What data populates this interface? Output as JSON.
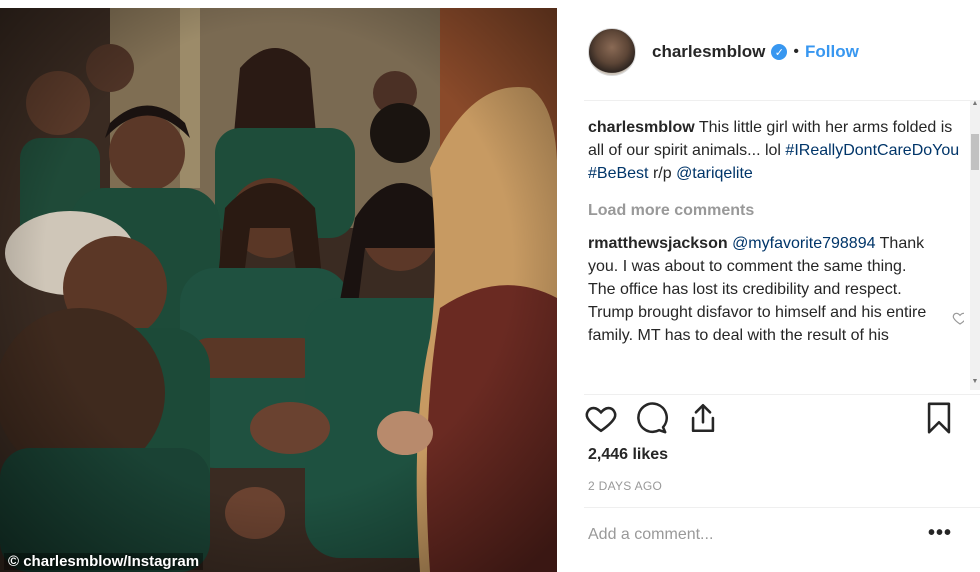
{
  "photo": {
    "credit": "© charlesmblow/Instagram"
  },
  "post": {
    "username": "charlesmblow",
    "verified_icon": "verified-badge-icon",
    "follow_label": "Follow",
    "separator": "•"
  },
  "caption": {
    "username": "charlesmblow",
    "text": "This little girl with her arms folded is all of our spirit animals... lol",
    "hashtags": "#IReallyDontCareDoYou #BeBest",
    "suffix": "r/p",
    "mention": "@tariqelite"
  },
  "load_more": "Load more comments",
  "reply": {
    "username": "rmatthewsjackson",
    "mention": "@myfavorite798894",
    "text": "Thank you. I was about to comment the same thing. The office has lost its credibility and respect. Trump brought disfavor to himself and his entire family. MT has to deal with the result of his"
  },
  "actions": {
    "like_icon": "heart-icon",
    "comment_icon": "comment-icon",
    "share_icon": "share-icon",
    "save_icon": "bookmark-icon"
  },
  "likes": "2,446 likes",
  "time": "2 DAYS AGO",
  "add_comment_placeholder": "Add a comment...",
  "more_label": "•••",
  "colors": {
    "link_blue": "#3897f0",
    "tag_blue": "#003569",
    "muted": "#999999"
  }
}
